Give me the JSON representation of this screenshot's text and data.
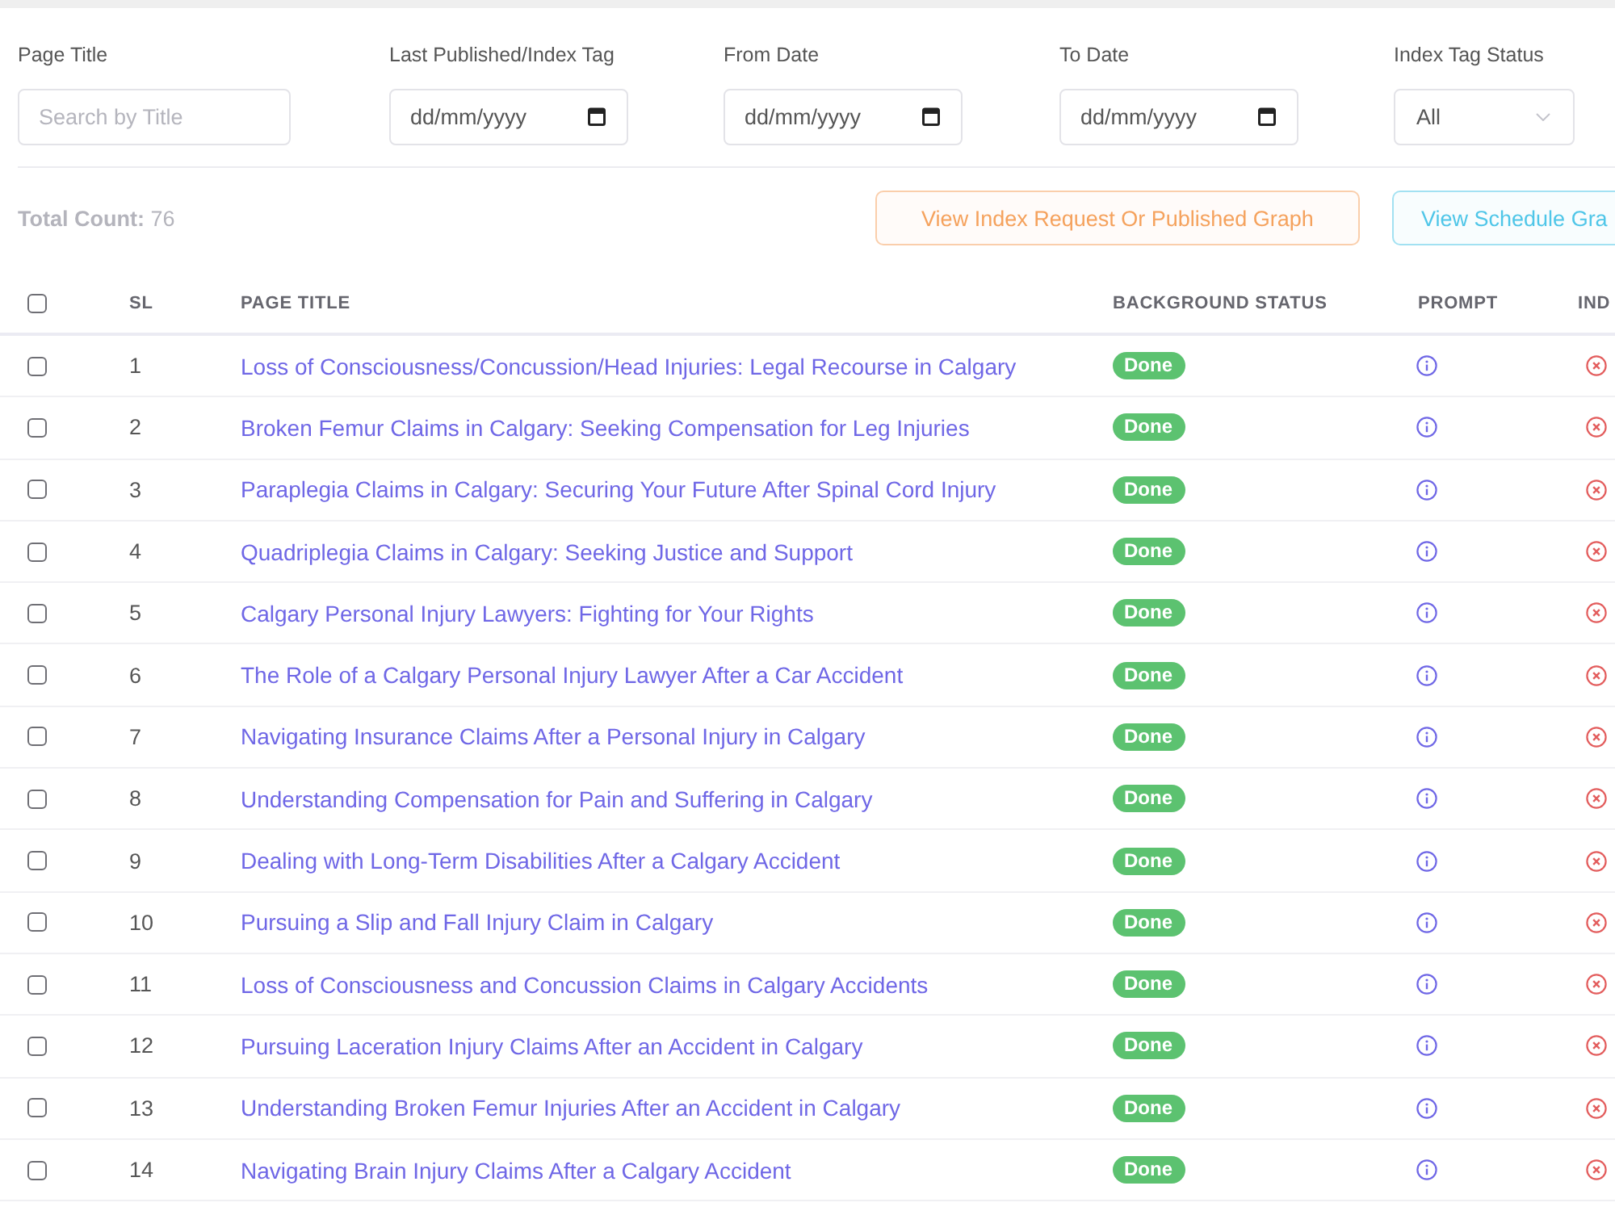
{
  "filters": [
    {
      "kind": "text",
      "label": "Page Title",
      "placeholder": "Search by Title"
    },
    {
      "kind": "date",
      "label": "Last Published/Index Tag",
      "placeholder": "dd/mm/yyyy"
    },
    {
      "kind": "date",
      "label": "From Date",
      "placeholder": "dd/mm/yyyy"
    },
    {
      "kind": "date",
      "label": "To Date",
      "placeholder": "dd/mm/yyyy"
    },
    {
      "kind": "select",
      "label": "Index Tag Status",
      "value": "All"
    }
  ],
  "summary": "**Total Count:** 76",
  "actions": [
    {
      "label": "View Index Request Or Published Graph",
      "color": "#f5a25d"
    },
    {
      "label": "View Schedule Gra",
      "color": "#4fc6e8"
    }
  ],
  "table": {
    "select_all": {
      "checked": false
    },
    "columns": [
      "SL",
      "PAGE TITLE",
      "BACKGROUND STATUS",
      "PROMPT",
      "IND"
    ],
    "rows": [
      {
        "checked": false,
        "sl": "1",
        "title": "Loss of Consciousness/Concussion/Head Injuries: Legal Recourse in Calgary",
        "status": "Done",
        "indexed": false
      },
      {
        "checked": false,
        "sl": "2",
        "title": "Broken Femur Claims in Calgary: Seeking Compensation for Leg Injuries",
        "status": "Done",
        "indexed": false
      },
      {
        "checked": false,
        "sl": "3",
        "title": "Paraplegia Claims in Calgary: Securing Your Future After Spinal Cord Injury",
        "status": "Done",
        "indexed": false
      },
      {
        "checked": false,
        "sl": "4",
        "title": "Quadriplegia Claims in Calgary: Seeking Justice and Support",
        "status": "Done",
        "indexed": false
      },
      {
        "checked": false,
        "sl": "5",
        "title": "Calgary Personal Injury Lawyers: Fighting for Your Rights",
        "status": "Done",
        "indexed": false
      },
      {
        "checked": false,
        "sl": "6",
        "title": "The Role of a Calgary Personal Injury Lawyer After a Car Accident",
        "status": "Done",
        "indexed": false
      },
      {
        "checked": false,
        "sl": "7",
        "title": "Navigating Insurance Claims After a Personal Injury in Calgary",
        "status": "Done",
        "indexed": false
      },
      {
        "checked": false,
        "sl": "8",
        "title": "Understanding Compensation for Pain and Suffering in Calgary",
        "status": "Done",
        "indexed": false
      },
      {
        "checked": false,
        "sl": "9",
        "title": "Dealing with Long-Term Disabilities After a Calgary Accident",
        "status": "Done",
        "indexed": false
      },
      {
        "checked": false,
        "sl": "10",
        "title": "Pursuing a Slip and Fall Injury Claim in Calgary",
        "status": "Done",
        "indexed": false
      },
      {
        "checked": false,
        "sl": "11",
        "title": "Loss of Consciousness and Concussion Claims in Calgary Accidents",
        "status": "Done",
        "indexed": false
      },
      {
        "checked": false,
        "sl": "12",
        "title": "Pursuing Laceration Injury Claims After an Accident in Calgary",
        "status": "Done",
        "indexed": false
      },
      {
        "checked": false,
        "sl": "13",
        "title": "Understanding Broken Femur Injuries After an Accident in Calgary",
        "status": "Done",
        "indexed": false
      },
      {
        "checked": false,
        "sl": "14",
        "title": "Navigating Brain Injury Claims After a Calgary Accident",
        "status": "Done",
        "indexed": false
      }
    ]
  }
}
